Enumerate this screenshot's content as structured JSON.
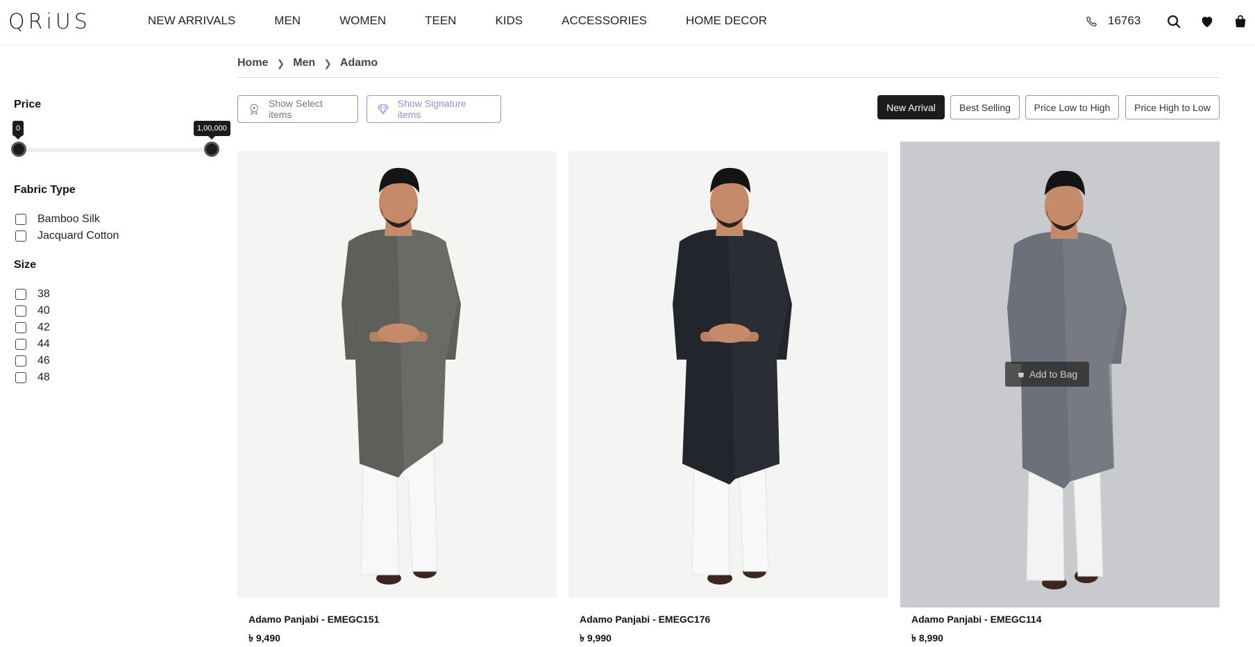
{
  "header": {
    "logo": "QRiUS",
    "nav": [
      "NEW ARRIVALS",
      "MEN",
      "WOMEN",
      "TEEN",
      "KIDS",
      "ACCESSORIES",
      "HOME DECOR"
    ],
    "phone": "16763",
    "icons": [
      "phone-icon",
      "search-icon",
      "heart-icon",
      "bag-icon"
    ]
  },
  "breadcrumb": [
    "Home",
    "Men",
    "Adamo"
  ],
  "sidebar": {
    "price": {
      "title": "Price",
      "min_label": "0",
      "max_label": "1,00,000",
      "min_value": 0,
      "max_value": 100000
    },
    "fabric": {
      "title": "Fabric Type",
      "options": [
        "Bamboo Silk",
        "Jacquard Cotton"
      ]
    },
    "size": {
      "title": "Size",
      "options": [
        "38",
        "40",
        "42",
        "44",
        "46",
        "48"
      ]
    }
  },
  "toolbar": {
    "select_label": "Show Select items",
    "signature_label": "Show Signature items",
    "sort_options": [
      "New Arrival",
      "Best Selling",
      "Price Low to High",
      "Price High to Low"
    ],
    "active_sort": "New Arrival"
  },
  "products": [
    {
      "title": "Adamo Panjabi - EMEGC151",
      "price": "৳ 9,490",
      "jacket_color": "#5d5f5a",
      "pattern_color": "#6f716b"
    },
    {
      "title": "Adamo Panjabi - EMEGC176",
      "price": "৳ 9,990",
      "jacket_color": "#23252c",
      "pattern_color": "#2f3139"
    },
    {
      "title": "Adamo Panjabi - EMEGC114",
      "price": "৳ 8,990",
      "jacket_color": "#6d707a",
      "pattern_color": "#7c7f86"
    }
  ],
  "hover_button": "Add to Bag",
  "colors": {
    "accent": "#1c1c1c",
    "signature": "#a08de0"
  }
}
